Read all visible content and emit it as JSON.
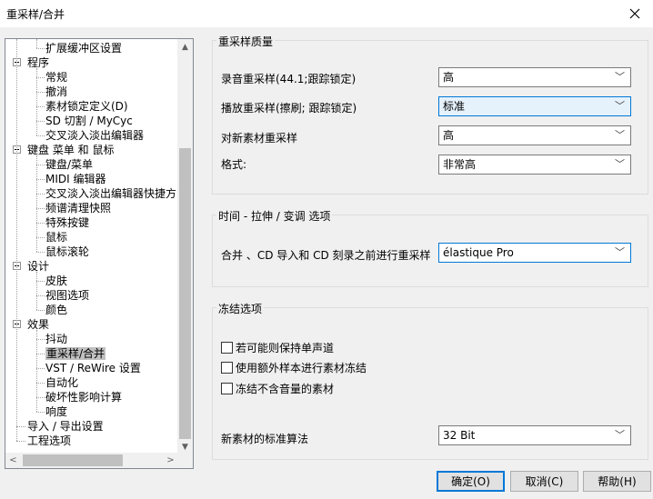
{
  "window": {
    "title": "重采样/合并",
    "close_glyph": "✕"
  },
  "tree": {
    "items": [
      {
        "label": "扩展缓冲区设置",
        "level": 2
      },
      {
        "label": "程序",
        "level": 1,
        "expander": true
      },
      {
        "label": "常规",
        "level": 2
      },
      {
        "label": "撤消",
        "level": 2
      },
      {
        "label": "素材锁定定义(D)",
        "level": 2
      },
      {
        "label": "SD 切割 / MyCyc",
        "level": 2
      },
      {
        "label": "交叉淡入淡出编辑器",
        "level": 2
      },
      {
        "label": "键盘 菜单 和 鼠标",
        "level": 1,
        "expander": true
      },
      {
        "label": "键盘/菜单",
        "level": 2
      },
      {
        "label": "MIDI 编辑器",
        "level": 2
      },
      {
        "label": "交叉淡入淡出编辑器快捷方",
        "level": 2
      },
      {
        "label": "频谱清理快照",
        "level": 2
      },
      {
        "label": "特殊按键",
        "level": 2
      },
      {
        "label": "鼠标",
        "level": 2
      },
      {
        "label": "鼠标滚轮",
        "level": 2
      },
      {
        "label": "设计",
        "level": 1,
        "expander": true
      },
      {
        "label": "皮肤",
        "level": 2
      },
      {
        "label": "视图选项",
        "level": 2
      },
      {
        "label": "颜色",
        "level": 2
      },
      {
        "label": "效果",
        "level": 1,
        "expander": true
      },
      {
        "label": "抖动",
        "level": 2
      },
      {
        "label": "重采样/合并",
        "level": 2,
        "selected": true
      },
      {
        "label": "VST / ReWire 设置",
        "level": 2
      },
      {
        "label": "自动化",
        "level": 2
      },
      {
        "label": "破坏性影响计算",
        "level": 2
      },
      {
        "label": "响度",
        "level": 2
      },
      {
        "label": "导入 / 导出设置",
        "level": 1
      },
      {
        "label": "工程选项",
        "level": 1
      }
    ],
    "scroll_up": "▲",
    "scroll_down": "▼",
    "scroll_left": "<",
    "scroll_right": ">"
  },
  "quality": {
    "title": "重采样质量",
    "rows": [
      {
        "label": "录音重采样(44.1;跟踪锁定)",
        "value": "高"
      },
      {
        "label": "播放重采样(擦刷; 跟踪锁定)",
        "value": "标准"
      },
      {
        "label": "对新素材重采样",
        "value": "高"
      },
      {
        "label": "格式:",
        "value": "非常高"
      }
    ]
  },
  "timestretch": {
    "title": "时间 - 拉伸 /  变调 选项",
    "label": "合并 、CD 导入和 CD 刻录之前进行重采样",
    "value": "élastique Pro"
  },
  "freeze": {
    "title": "冻结选项",
    "checkboxes": [
      "若可能则保持单声道",
      "使用额外样本进行素材冻结",
      "冻结不含音量的素材"
    ],
    "algo_label": "新素材的标准算法",
    "algo_value": "32 Bit"
  },
  "buttons": {
    "ok": "确定(O)",
    "cancel": "取消(C)",
    "help": "帮助(H)"
  },
  "dropdown_glyph": "﹀"
}
